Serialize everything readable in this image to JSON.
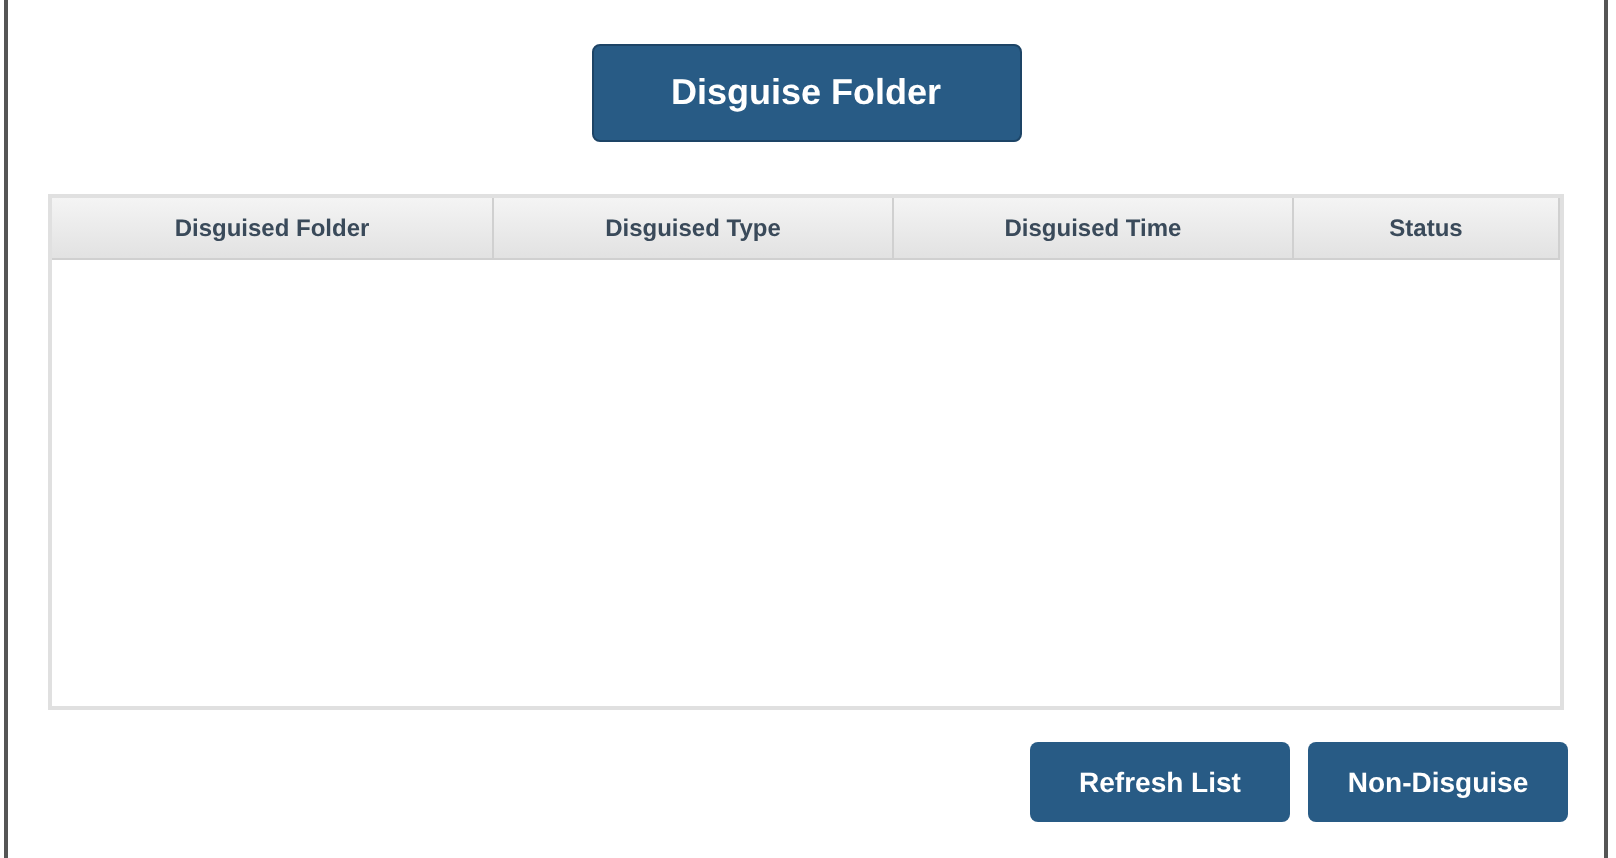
{
  "top_button": {
    "label": "Disguise Folder"
  },
  "table": {
    "columns": [
      "Disguised Folder",
      "Disguised Type",
      "Disguised Time",
      "Status"
    ]
  },
  "buttons": [
    "Refresh List",
    "Non-Disguise"
  ]
}
